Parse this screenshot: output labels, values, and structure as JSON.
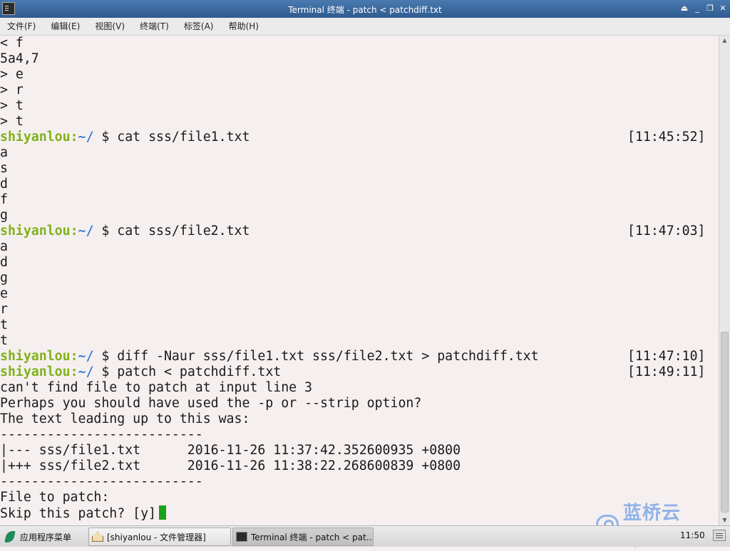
{
  "window": {
    "title": "Terminal 终端 - patch < patchdiff.txt",
    "controls": [
      "⏏",
      "_",
      "❐",
      "✕"
    ]
  },
  "menubar": {
    "items": [
      "文件(F)",
      "编辑(E)",
      "视图(V)",
      "终端(T)",
      "标签(A)",
      "帮助(H)"
    ]
  },
  "terminal": {
    "lines": [
      {
        "text": "< f"
      },
      {
        "text": "5a4,7"
      },
      {
        "text": "> e"
      },
      {
        "text": "> r"
      },
      {
        "text": "> t"
      },
      {
        "text": "> t"
      },
      {
        "prompt": {
          "user": "shiyanlou",
          "sep": ":",
          "path": "~/",
          "symbol": " $ "
        },
        "text": "cat sss/file1.txt",
        "time": "[11:45:52]"
      },
      {
        "text": "a"
      },
      {
        "text": "s"
      },
      {
        "text": "d"
      },
      {
        "text": "f"
      },
      {
        "text": "g"
      },
      {
        "prompt": {
          "user": "shiyanlou",
          "sep": ":",
          "path": "~/",
          "symbol": " $ "
        },
        "text": "cat sss/file2.txt",
        "time": "[11:47:03]"
      },
      {
        "text": "a"
      },
      {
        "text": "d"
      },
      {
        "text": "g"
      },
      {
        "text": "e"
      },
      {
        "text": "r"
      },
      {
        "text": "t"
      },
      {
        "text": "t"
      },
      {
        "prompt": {
          "user": "shiyanlou",
          "sep": ":",
          "path": "~/",
          "symbol": " $ "
        },
        "text": "diff -Naur sss/file1.txt sss/file2.txt > patchdiff.txt",
        "time": "[11:47:10]"
      },
      {
        "prompt": {
          "user": "shiyanlou",
          "sep": ":",
          "path": "~/",
          "symbol": " $ "
        },
        "text": "patch < patchdiff.txt",
        "time": "[11:49:11]"
      },
      {
        "text": "can't find file to patch at input line 3"
      },
      {
        "text": "Perhaps you should have used the -p or --strip option?"
      },
      {
        "text": "The text leading up to this was:"
      },
      {
        "text": "--------------------------"
      },
      {
        "text": "|--- sss/file1.txt      2016-11-26 11:37:42.352600935 +0800"
      },
      {
        "text": "|+++ sss/file2.txt      2016-11-26 11:38:22.268600839 +0800"
      },
      {
        "text": "--------------------------"
      },
      {
        "text": "File to patch:"
      },
      {
        "text": "Skip this patch? [y]",
        "cursor": true
      }
    ]
  },
  "taskbar": {
    "start_label": "应用程序菜单",
    "tasks": [
      {
        "label": "[shiyanlou - 文件管理器]",
        "icon": "home-folder-icon",
        "active": false
      },
      {
        "label": "Terminal 终端 - patch < pat…",
        "icon": "terminal-icon",
        "active": true
      }
    ],
    "clock": "11:50",
    "brand": "蓝桥云课"
  },
  "colors": {
    "prompt_user": "#7fb21a",
    "prompt_path": "#3a7fd6",
    "cursor": "#1aa11a",
    "terminal_bg": "#f6efef"
  }
}
